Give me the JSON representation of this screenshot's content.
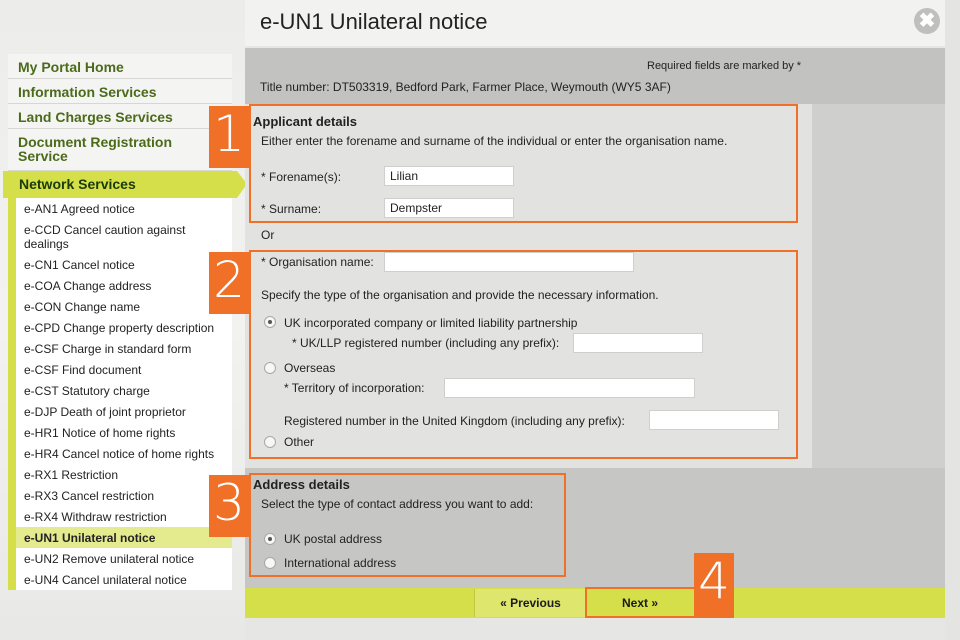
{
  "window": {
    "title": "e-UN1 Unilateral notice",
    "close_symbol": "✖"
  },
  "sidebar": {
    "main_items": [
      {
        "label": "My Portal Home"
      },
      {
        "label": "Information Services"
      },
      {
        "label": "Land Charges Services"
      },
      {
        "label": "Document Registration Service"
      }
    ],
    "active_section": "Network Services",
    "sub_items": [
      {
        "label": "e-AN1 Agreed notice"
      },
      {
        "label": "e-CCD Cancel caution against dealings"
      },
      {
        "label": "e-CN1 Cancel notice"
      },
      {
        "label": "e-COA Change address"
      },
      {
        "label": "e-CON Change name"
      },
      {
        "label": "e-CPD Change property description"
      },
      {
        "label": "e-CSF Charge in standard form"
      },
      {
        "label": "e-CSF Find document"
      },
      {
        "label": "e-CST Statutory charge"
      },
      {
        "label": "e-DJP Death of joint proprietor"
      },
      {
        "label": "e-HR1 Notice of home rights"
      },
      {
        "label": "e-HR4 Cancel notice of home rights"
      },
      {
        "label": "e-RX1 Restriction"
      },
      {
        "label": "e-RX3 Cancel restriction"
      },
      {
        "label": "e-RX4 Withdraw restriction"
      },
      {
        "label": "e-UN1 Unilateral notice"
      },
      {
        "label": "e-UN2 Remove unilateral notice"
      },
      {
        "label": "e-UN4 Cancel unilateral notice"
      }
    ]
  },
  "info": {
    "required_note": "Required fields are marked by *",
    "title_number": "Title number: DT503319, Bedford Park, Farmer Place, Weymouth (WY5 3AF)"
  },
  "applicant": {
    "heading": "Applicant details",
    "instruction": "Either enter the forename and surname of the individual or enter the organisation name.",
    "forename_label": "* Forename(s):",
    "forename_value": "Lilian",
    "surname_label": "* Surname:",
    "surname_value": "Dempster",
    "or_label": "Or"
  },
  "organisation": {
    "name_label": "* Organisation name:",
    "name_value": "",
    "instruction": "Specify the type of the organisation and provide the necessary information.",
    "uk_option": "UK incorporated company or limited liability partnership",
    "uk_number_label": "* UK/LLP registered number (including any prefix):",
    "overseas_option": "Overseas",
    "territory_label": "* Territory of incorporation:",
    "uk_registered_label": "Registered number in the United Kingdom (including any prefix):",
    "other_option": "Other",
    "selected": "uk"
  },
  "address": {
    "heading": "Address details",
    "instruction": "Select the type of contact address you want to add:",
    "uk_option": "UK postal address",
    "intl_option": "International address",
    "selected": "uk"
  },
  "buttons": {
    "previous": "« Previous",
    "next": "Next »"
  },
  "callouts": [
    "1",
    "2",
    "3",
    "4"
  ],
  "colors": {
    "accent_orange": "#f07028",
    "brand_lime": "#d4df4a",
    "nav_green": "#4b6b1b"
  }
}
